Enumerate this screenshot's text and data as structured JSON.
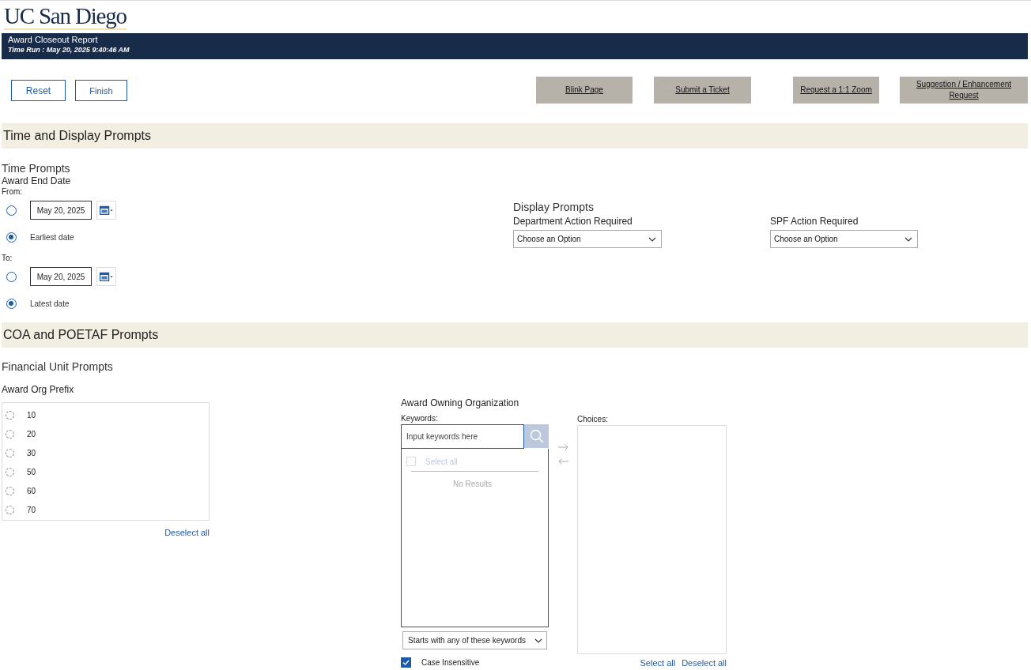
{
  "header": {
    "logo": "UC San Diego",
    "report_title": "Award Closeout Report",
    "time_run": "Time Run : May 20, 2025 9:40:46 AM"
  },
  "buttons": [
    {
      "label": "Reset"
    },
    {
      "label": "Finish"
    }
  ],
  "links": [
    {
      "label": "Blink Page"
    },
    {
      "label": "Submit a Ticket"
    },
    {
      "label": "Request a 1:1 Zoom"
    },
    {
      "label": "Suggestion / Enhancement Request"
    }
  ],
  "time_display_section": {
    "title": "Time and Display Prompts",
    "time_prompts": {
      "title": "Time Prompts",
      "label": "Award End Date",
      "ranges": [
        {
          "label": "From:",
          "date_value": "May 20, 2025",
          "date_selected": false,
          "default_label": "Earliest date",
          "default_selected": true
        },
        {
          "label": "To:",
          "date_value": "May 20, 2025",
          "date_selected": false,
          "default_label": "Latest date",
          "default_selected": true
        }
      ]
    },
    "display_prompts": {
      "title": "Display Prompts",
      "dropdowns": [
        {
          "label": "Department Action Required",
          "value": "Choose an Option"
        },
        {
          "label": "SPF Action Required",
          "value": "Choose an Option"
        }
      ]
    }
  },
  "coa_section": {
    "title": "COA and POETAF Prompts",
    "subtitle": "Financial Unit Prompts",
    "org_prefix": {
      "label": "Award Org Prefix",
      "options": [
        {
          "label": "10",
          "selected": false
        },
        {
          "label": "20",
          "selected": false
        },
        {
          "label": "30",
          "selected": false
        },
        {
          "label": "50",
          "selected": false
        },
        {
          "label": "60",
          "selected": false
        },
        {
          "label": "70",
          "selected": false
        }
      ],
      "deselect_all": "Deselect all"
    },
    "owning_org": {
      "label": "Award Owning Organization",
      "keywords_label": "Keywords:",
      "placeholder": "Input keywords here",
      "select_all": "Select all",
      "select_all_checked": false,
      "no_results": "No Results",
      "match_mode": "Starts with any of these keywords",
      "case_insensitive": {
        "label": "Case Insensitive",
        "checked": true
      },
      "choices_label": "Choices:",
      "choices_select_all": "Select all",
      "choices_deselect_all": "Deselect all"
    }
  }
}
